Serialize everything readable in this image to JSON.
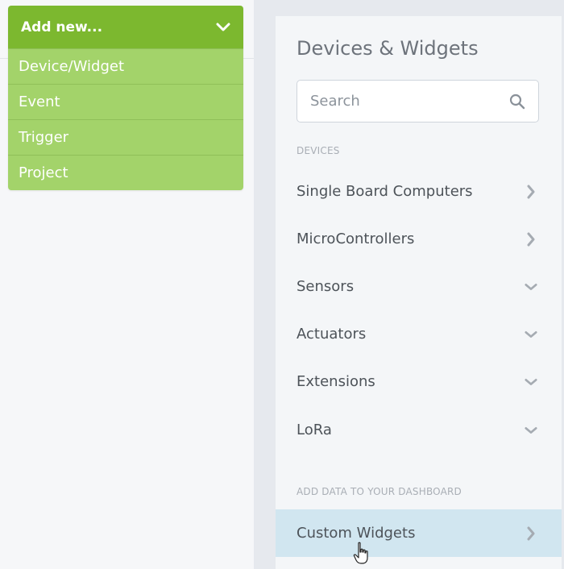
{
  "add_menu": {
    "button_label": "Add new...",
    "items": [
      {
        "label": "Device/Widget"
      },
      {
        "label": "Event"
      },
      {
        "label": "Trigger"
      },
      {
        "label": "Project"
      }
    ]
  },
  "panel": {
    "title": "Devices & Widgets",
    "search": {
      "placeholder": "Search",
      "value": ""
    },
    "devices_section_label": "DEVICES",
    "devices": [
      {
        "label": "Single Board Computers",
        "state": "collapsed-right"
      },
      {
        "label": "MicroControllers",
        "state": "collapsed-right"
      },
      {
        "label": "Sensors",
        "state": "expandable-down"
      },
      {
        "label": "Actuators",
        "state": "expandable-down"
      },
      {
        "label": "Extensions",
        "state": "expandable-down"
      },
      {
        "label": "LoRa",
        "state": "expandable-down"
      }
    ],
    "dashboard_section_label": "ADD DATA TO YOUR DASHBOARD",
    "dashboard_items": [
      {
        "label": "Custom Widgets",
        "state": "hovered"
      }
    ]
  },
  "colors": {
    "add_button": "#7cb82f",
    "menu_item": "#a3d36a",
    "hover_row": "#d1e6f0",
    "panel_bg": "#f4f6f8"
  },
  "icons": {
    "add_button": "chevron-down-icon",
    "search": "search-icon",
    "row_right": "chevron-right-icon",
    "row_down": "chevron-down-icon",
    "cursor": "hand-pointer-icon"
  }
}
